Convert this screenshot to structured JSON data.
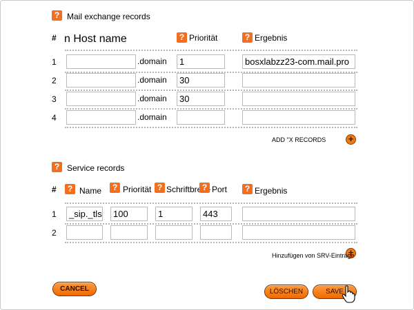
{
  "mx": {
    "title": "Mail exchange records",
    "hash": "#",
    "col_host": "n Host name",
    "col_priority": "Priorität",
    "col_result": "Ergebnis",
    "domain_suffix": ".domain",
    "rows": [
      {
        "num": "1",
        "host": "",
        "priority": "1",
        "result": "bosxlabzz23-com.mail.pro"
      },
      {
        "num": "2",
        "host": "",
        "priority": "30",
        "result": ""
      },
      {
        "num": "3",
        "host": "",
        "priority": "30",
        "result": ""
      },
      {
        "num": "4",
        "host": "",
        "priority": "",
        "result": ""
      }
    ],
    "add_label": "ADD \"X RECORDS"
  },
  "srv": {
    "title": "Service records",
    "hash": "#",
    "col_name": "Name",
    "col_priority": "Priorität",
    "col_weight": "Schriftbreite",
    "col_port": "Port",
    "col_result": "Ergebnis",
    "rows": [
      {
        "num": "1",
        "name": "_sip._tls",
        "priority": "100",
        "weight": "1",
        "port": "443",
        "result": ""
      },
      {
        "num": "2",
        "name": "",
        "priority": "",
        "weight": "",
        "port": "",
        "result": ""
      }
    ],
    "add_label": "Hinzufügen von SRV-Einträge"
  },
  "buttons": {
    "cancel": "CANCEL",
    "delete": "LÖSCHEN",
    "save": "SAVE"
  },
  "icons": {
    "help": "?",
    "plus": "+"
  }
}
